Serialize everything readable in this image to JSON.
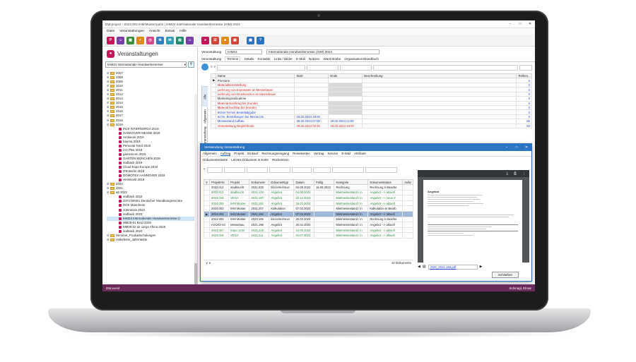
{
  "window": {
    "title": "DW.project - 2024.003 IHM Mustermann | IHM24 Internationale Handwerksmesse (IHM) 2024"
  },
  "menu": [
    "Datei",
    "Veranstaltungen",
    "Ansicht",
    "Extras",
    "Hilfe"
  ],
  "toolbar_icons": [
    {
      "name": "project-icon",
      "color": "#c2185b",
      "glyph": "P"
    },
    {
      "name": "people-icon",
      "color": "#7a3ea8",
      "glyph": "☺"
    },
    {
      "name": "calendar-icon",
      "color": "#3c8d3c",
      "glyph": "▦"
    },
    {
      "name": "task-icon",
      "color": "#e08a14",
      "glyph": "✓"
    },
    {
      "name": "clock-icon",
      "color": "#d34a8c",
      "glyph": "◷"
    },
    {
      "name": "gear-icon",
      "color": "#2d7fc1",
      "glyph": "⚙"
    },
    {
      "name": "mail-icon",
      "color": "#35a0b5",
      "glyph": "✉"
    },
    {
      "name": "document-icon",
      "color": "#1f8a70",
      "glyph": "▤"
    },
    {
      "name": "user-icon",
      "color": "#7a3ea8",
      "glyph": "☺"
    },
    {
      "name": "event-icon",
      "color": "#c2185b",
      "glyph": "●"
    },
    {
      "name": "chart-icon",
      "color": "#d2453a",
      "glyph": "☰"
    },
    {
      "name": "folder-icon",
      "color": "#e08a14",
      "glyph": "■"
    },
    {
      "name": "print-icon",
      "color": "#d2453a",
      "glyph": "▣"
    },
    {
      "name": "grid-icon",
      "color": "#2b73c3",
      "glyph": "▦"
    },
    {
      "name": "help-icon",
      "color": "#2b73c3",
      "glyph": "?"
    }
  ],
  "left_panel": {
    "title": "Veranstaltungen",
    "filter_value": "IHM24 Internationale Handwerksmesse",
    "tree": [
      {
        "label": "2007",
        "type": "folder",
        "depth": 0
      },
      {
        "label": "2008",
        "type": "folder",
        "depth": 0
      },
      {
        "label": "2009",
        "type": "folder",
        "depth": 0
      },
      {
        "label": "2010",
        "type": "folder",
        "depth": 0
      },
      {
        "label": "2011",
        "type": "folder",
        "depth": 0
      },
      {
        "label": "2012",
        "type": "folder",
        "depth": 0
      },
      {
        "label": "2013",
        "type": "folder",
        "depth": 0
      },
      {
        "label": "2014",
        "type": "folder",
        "depth": 0
      },
      {
        "label": "2015",
        "type": "folder",
        "depth": 0
      },
      {
        "label": "2016",
        "type": "folder",
        "depth": 0
      },
      {
        "label": "2017",
        "type": "folder",
        "depth": 0
      },
      {
        "label": "2018",
        "type": "folder",
        "depth": 0
      },
      {
        "label": "2019",
        "type": "folder",
        "depth": 0
      },
      {
        "label": "IN19 INTERNORGA 2019",
        "type": "event",
        "depth": 1
      },
      {
        "label": "HANNOVER MESSE 2019",
        "type": "event",
        "depth": 1
      },
      {
        "label": "Ambiente 2019",
        "type": "event",
        "depth": 1
      },
      {
        "label": "bauma 2019",
        "type": "event",
        "depth": 1
      },
      {
        "label": "Personal Nord 2019",
        "type": "event",
        "depth": 1
      },
      {
        "label": "IAA Pkw 2019",
        "type": "event",
        "depth": 1
      },
      {
        "label": "gamescom 2019",
        "type": "event",
        "depth": 1
      },
      {
        "label": "GARTEN MÜNCHEN 2019",
        "type": "event",
        "depth": 1
      },
      {
        "label": "südback 2019",
        "type": "event",
        "depth": 1
      },
      {
        "label": "Cloud Expo Europe 2019",
        "type": "event",
        "depth": 1
      },
      {
        "label": "ITB Berlin 2019",
        "type": "event",
        "depth": 1
      },
      {
        "label": "DOMOTEX HANNOVER 2019",
        "type": "event",
        "depth": 1
      },
      {
        "label": "Heimtextil 2019",
        "type": "event",
        "depth": 1
      },
      {
        "label": "2020",
        "type": "folder",
        "depth": 0
      },
      {
        "label": "2021",
        "type": "folder",
        "depth": 0
      },
      {
        "label": "ab 2022",
        "type": "folder",
        "depth": 0
      },
      {
        "label": "südback 2022",
        "type": "event",
        "depth": 1
      },
      {
        "label": "3374 DEWU Deutscher Wundkongress Bre",
        "type": "event",
        "depth": 1
      },
      {
        "label": "DGK Mannheim",
        "type": "event",
        "depth": 1
      },
      {
        "label": "Jobmesse 2023",
        "type": "event",
        "depth": 1
      },
      {
        "label": "südback 2023",
        "type": "event",
        "depth": 1
      },
      {
        "label": "IHM24 Internationale Handwerksmesse (I",
        "type": "event",
        "depth": 1,
        "selected": true
      },
      {
        "label": "MM25-01 BAU 2025",
        "type": "event",
        "depth": 1
      },
      {
        "label": "MM25-02 air cargo Africa 2025",
        "type": "event",
        "depth": 1
      },
      {
        "label": "südback 2024",
        "type": "event",
        "depth": 1
      },
      {
        "label": "Seminar_Produktschulungen",
        "type": "folder",
        "depth": 0
      },
      {
        "label": "Volksfeste_Jahrmärkte",
        "type": "folder",
        "depth": 0
      }
    ]
  },
  "main": {
    "event_label": "Veranstaltung",
    "event_code": "IHM24",
    "event_name": "Internationale Handwerksmesse (IHM) 2024",
    "tabs": [
      "Veranstaltung",
      "Termine",
      "Details",
      "Kontakte",
      "Links / Bilder",
      "E-Mail",
      "Notizen",
      "Warenkörbe",
      "Organisationshandbuch"
    ],
    "active_tab": "Termine",
    "vertical_tabs": [
      "Alle",
      "Allgemein",
      "Veranstaltung"
    ],
    "columns": [
      "Name",
      "Start",
      "Ende",
      "Beschreibung",
      "Reihen..."
    ],
    "rows": [
      {
        "name": "Premiere",
        "start": "",
        "end": "",
        "desc": "",
        "num": "0",
        "color": "black"
      },
      {
        "name": "Materialbereitstellung",
        "start": "",
        "end": "",
        "desc": "",
        "num": "0",
        "color": "red"
      },
      {
        "name": "Lieferung von Exponaten an Messebauer",
        "start": "",
        "end": "",
        "desc": "",
        "num": "0",
        "color": "red"
      },
      {
        "name": "Lieferung von Drucksachen an Messebauer",
        "start": "",
        "end": "",
        "desc": "",
        "num": "0",
        "color": "red"
      },
      {
        "name": "Marketingmaßnahme",
        "start": "",
        "end": "",
        "desc": "",
        "num": "0",
        "color": "black"
      },
      {
        "name": "Material Nachtrag bis (Kunde)",
        "start": "",
        "end": "",
        "desc": "",
        "num": "0",
        "color": "red"
      },
      {
        "name": "Material buchbar bis (Kunde)",
        "start": "",
        "end": "",
        "desc": "",
        "num": "0",
        "color": "red"
      },
      {
        "name": "letzter Termin Bestellabgabe",
        "start": "",
        "end": "",
        "desc": "",
        "num": "0",
        "color": "blue"
      },
      {
        "name": "techn. Bestellungen bei Messe bis",
        "start": "19.02.2024 18:00",
        "end": "",
        "desc": "",
        "num": "0",
        "color": "blue"
      },
      {
        "name": "Messestand Aufbau",
        "start": "25.02.2024 07:00",
        "end": "28.02.2024 22:00",
        "desc": "",
        "num": "82",
        "color": "blue"
      },
      {
        "name": "Veranstaltung Beginn/Ende",
        "start": "28.02.2024 09:30",
        "end": "03.03.2024 18:00",
        "desc": "",
        "num": "83",
        "color": "red"
      }
    ]
  },
  "popup": {
    "title": "Verwendung Veranstaltung",
    "menu": [
      "Allgemein",
      "Auftrag",
      "Projekt",
      "Einkauf",
      "Rechnungseingang",
      "Reisekosten",
      "Vertrag",
      "Service",
      "E-Mail",
      "Attribute"
    ],
    "active_menu": "Auftrag",
    "submenu": [
      "Dokumentenkette",
      "Letztes Dokument in Kette",
      "Rücksetzen"
    ],
    "columns": [
      "Projekt-Nr.",
      "Projekt",
      "Dokument-",
      "Dokumenttyp",
      "Datum",
      "Fällig",
      "Kategorie",
      "Dokumentstatus",
      "Aufw"
    ],
    "rows": [
      {
        "c": [
          "2022.012",
          "stadtsucht",
          "2021.028",
          "Einzelrechnun",
          "04.08.2022",
          "18.08.2022",
          "Rechnung",
          "Rechnung in Bearbe"
        ],
        "style": "normal"
      },
      {
        "c": [
          "2022.012",
          "stadtsucht",
          "2021.125",
          "Angebot",
          "04.08.2022",
          "",
          "Mietmessestand / in",
          "Angebot --> aktuell"
        ],
        "style": "green"
      },
      {
        "c": [
          "2023.018",
          "VEGA",
          "2021.160",
          "Angebot",
          "20.12.2023",
          "",
          "Mietmessestand / in",
          "Angebot --> neue V"
        ],
        "style": "green"
      },
      {
        "c": [
          "2024.003",
          "IHM Muster",
          "2021.192",
          "Angebot",
          "26.01.2024",
          "",
          "Mietmessestand / in",
          "Angebot --> aktuell"
        ],
        "style": "green"
      },
      {
        "c": [
          "2024.003",
          "IHM Muster",
          "2021.207",
          "Kalkulation",
          "07.02.2024",
          "",
          "Mietmessestand / in",
          "Kalkulation in Bearb"
        ],
        "style": "normal"
      },
      {
        "c": [
          "2024.003",
          "IHM Muster",
          "2021.194",
          "Angebot",
          "07.02.2024",
          "",
          "Mietmessestand / in",
          "Angebot --> aktuell"
        ],
        "style": "selected"
      },
      {
        "c": [
          "2024.003",
          "IHM Muster",
          "2023.106",
          "Einzelrechnun",
          "20.02.2024",
          "",
          "Mietmessestand / in",
          "Rechnung in Bearbe"
        ],
        "style": "normal"
      },
      {
        "c": [
          "AIX202-03",
          "Messebau",
          "2021.198",
          "Angebot",
          "20.02.2024",
          "",
          "Mietmessestand / in",
          "Angebot --> aktuell"
        ],
        "style": "normal"
      },
      {
        "c": [
          "2024.007",
          "Expo 1234",
          "2021.228",
          "Angebot",
          "24.05.2024",
          "",
          "Mietmessestand / in",
          "Angebot --> aktuell"
        ],
        "style": "green"
      },
      {
        "c": [
          "2023.018",
          "VEGA",
          "2021.211",
          "Angebot",
          "04.07.2024",
          "",
          "Mietmessestand / in",
          "Angebot --> aktuell"
        ],
        "style": "green"
      }
    ],
    "count_text": "10 Dokumente",
    "preview_heading": "Angebot",
    "preview_file": "ANG_2021.194.pdf",
    "close_label": "Schließen"
  },
  "status": {
    "left": "DW.event",
    "user": "Schinagl, Elmar"
  }
}
